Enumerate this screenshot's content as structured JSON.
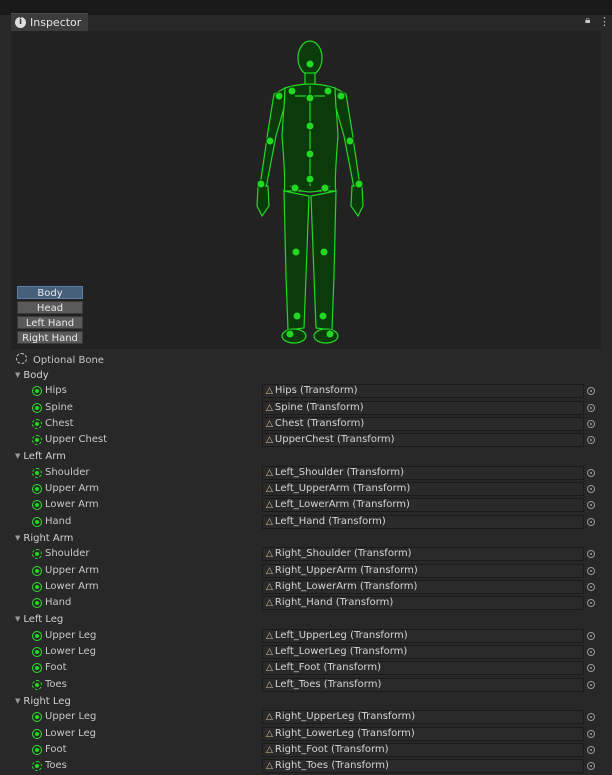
{
  "window": {
    "tab_title": "Inspector",
    "info_icon": "info-icon",
    "lock_icon": "lock-icon",
    "menu_icon": "kebab-menu-icon"
  },
  "avatar_preview": {
    "body_parts": [
      "Body",
      "Head",
      "Left Hand",
      "Right Hand"
    ],
    "active_part": "Body",
    "mapping_color": "#22d822"
  },
  "optional_bone_legend": "Optional Bone",
  "groups": [
    {
      "title": "Body",
      "bones": [
        {
          "name": "Hips",
          "value": "Hips (Transform)",
          "optional": false
        },
        {
          "name": "Spine",
          "value": "Spine (Transform)",
          "optional": false
        },
        {
          "name": "Chest",
          "value": "Chest (Transform)",
          "optional": true
        },
        {
          "name": "Upper Chest",
          "value": "UpperChest (Transform)",
          "optional": true
        }
      ]
    },
    {
      "title": "Left Arm",
      "bones": [
        {
          "name": "Shoulder",
          "value": "Left_Shoulder (Transform)",
          "optional": true
        },
        {
          "name": "Upper Arm",
          "value": "Left_UpperArm (Transform)",
          "optional": false
        },
        {
          "name": "Lower Arm",
          "value": "Left_LowerArm (Transform)",
          "optional": false
        },
        {
          "name": "Hand",
          "value": "Left_Hand (Transform)",
          "optional": false
        }
      ]
    },
    {
      "title": "Right Arm",
      "bones": [
        {
          "name": "Shoulder",
          "value": "Right_Shoulder (Transform)",
          "optional": true
        },
        {
          "name": "Upper Arm",
          "value": "Right_UpperArm (Transform)",
          "optional": false
        },
        {
          "name": "Lower Arm",
          "value": "Right_LowerArm (Transform)",
          "optional": false
        },
        {
          "name": "Hand",
          "value": "Right_Hand (Transform)",
          "optional": false
        }
      ]
    },
    {
      "title": "Left Leg",
      "bones": [
        {
          "name": "Upper Leg",
          "value": "Left_UpperLeg (Transform)",
          "optional": false
        },
        {
          "name": "Lower Leg",
          "value": "Left_LowerLeg (Transform)",
          "optional": false
        },
        {
          "name": "Foot",
          "value": "Left_Foot (Transform)",
          "optional": false
        },
        {
          "name": "Toes",
          "value": "Left_Toes (Transform)",
          "optional": true
        }
      ]
    },
    {
      "title": "Right Leg",
      "bones": [
        {
          "name": "Upper Leg",
          "value": "Right_UpperLeg (Transform)",
          "optional": false
        },
        {
          "name": "Lower Leg",
          "value": "Right_LowerLeg (Transform)",
          "optional": false
        },
        {
          "name": "Foot",
          "value": "Right_Foot (Transform)",
          "optional": false
        },
        {
          "name": "Toes",
          "value": "Right_Toes (Transform)",
          "optional": true
        }
      ]
    }
  ],
  "icons": {
    "bone_status": "bone-mapped-icon",
    "transform_field": "transform-icon",
    "object_picker": "object-picker-icon"
  }
}
